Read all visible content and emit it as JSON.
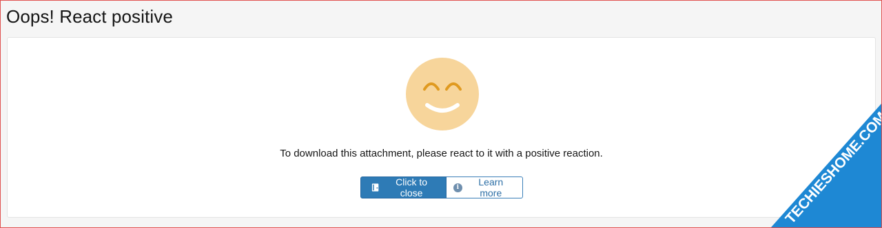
{
  "overlay": {
    "title": "Oops! React positive",
    "message": "To download this attachment, please react to it with a positive reaction.",
    "buttons": {
      "close_label": "Click to close",
      "learn_more_label": "Learn more"
    }
  },
  "icons": {
    "smiley": "smiling-face-icon",
    "close": "book-icon",
    "learn_more": "info-icon"
  },
  "colors": {
    "primary": "#2e7bb6",
    "smiley_face": "#f7d59b",
    "smiley_eyes": "#e09a20",
    "watermark": "#1e88d4"
  },
  "watermark": {
    "text": "TECHIESHOME.COM"
  }
}
